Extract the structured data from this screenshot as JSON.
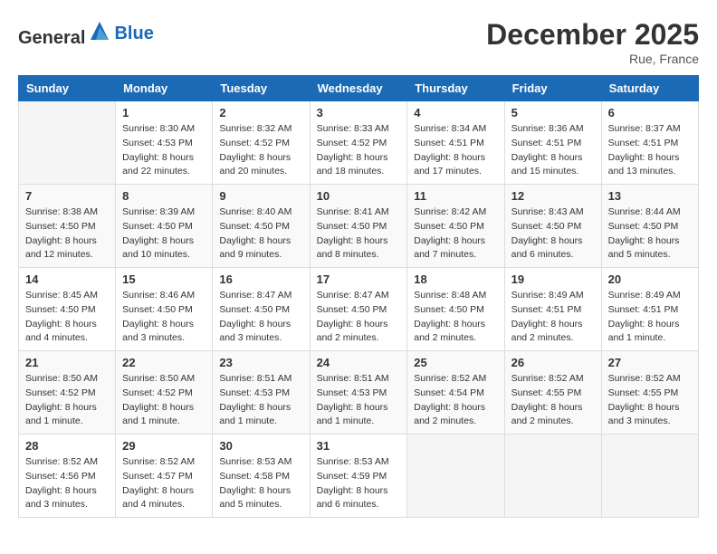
{
  "logo": {
    "general": "General",
    "blue": "Blue"
  },
  "header": {
    "month": "December 2025",
    "location": "Rue, France"
  },
  "weekdays": [
    "Sunday",
    "Monday",
    "Tuesday",
    "Wednesday",
    "Thursday",
    "Friday",
    "Saturday"
  ],
  "weeks": [
    [
      {
        "day": "",
        "sunrise": "",
        "sunset": "",
        "daylight": ""
      },
      {
        "day": "1",
        "sunrise": "8:30 AM",
        "sunset": "4:53 PM",
        "daylight": "8 hours and 22 minutes."
      },
      {
        "day": "2",
        "sunrise": "8:32 AM",
        "sunset": "4:52 PM",
        "daylight": "8 hours and 20 minutes."
      },
      {
        "day": "3",
        "sunrise": "8:33 AM",
        "sunset": "4:52 PM",
        "daylight": "8 hours and 18 minutes."
      },
      {
        "day": "4",
        "sunrise": "8:34 AM",
        "sunset": "4:51 PM",
        "daylight": "8 hours and 17 minutes."
      },
      {
        "day": "5",
        "sunrise": "8:36 AM",
        "sunset": "4:51 PM",
        "daylight": "8 hours and 15 minutes."
      },
      {
        "day": "6",
        "sunrise": "8:37 AM",
        "sunset": "4:51 PM",
        "daylight": "8 hours and 13 minutes."
      }
    ],
    [
      {
        "day": "7",
        "sunrise": "8:38 AM",
        "sunset": "4:50 PM",
        "daylight": "8 hours and 12 minutes."
      },
      {
        "day": "8",
        "sunrise": "8:39 AM",
        "sunset": "4:50 PM",
        "daylight": "8 hours and 10 minutes."
      },
      {
        "day": "9",
        "sunrise": "8:40 AM",
        "sunset": "4:50 PM",
        "daylight": "8 hours and 9 minutes."
      },
      {
        "day": "10",
        "sunrise": "8:41 AM",
        "sunset": "4:50 PM",
        "daylight": "8 hours and 8 minutes."
      },
      {
        "day": "11",
        "sunrise": "8:42 AM",
        "sunset": "4:50 PM",
        "daylight": "8 hours and 7 minutes."
      },
      {
        "day": "12",
        "sunrise": "8:43 AM",
        "sunset": "4:50 PM",
        "daylight": "8 hours and 6 minutes."
      },
      {
        "day": "13",
        "sunrise": "8:44 AM",
        "sunset": "4:50 PM",
        "daylight": "8 hours and 5 minutes."
      }
    ],
    [
      {
        "day": "14",
        "sunrise": "8:45 AM",
        "sunset": "4:50 PM",
        "daylight": "8 hours and 4 minutes."
      },
      {
        "day": "15",
        "sunrise": "8:46 AM",
        "sunset": "4:50 PM",
        "daylight": "8 hours and 3 minutes."
      },
      {
        "day": "16",
        "sunrise": "8:47 AM",
        "sunset": "4:50 PM",
        "daylight": "8 hours and 3 minutes."
      },
      {
        "day": "17",
        "sunrise": "8:47 AM",
        "sunset": "4:50 PM",
        "daylight": "8 hours and 2 minutes."
      },
      {
        "day": "18",
        "sunrise": "8:48 AM",
        "sunset": "4:50 PM",
        "daylight": "8 hours and 2 minutes."
      },
      {
        "day": "19",
        "sunrise": "8:49 AM",
        "sunset": "4:51 PM",
        "daylight": "8 hours and 2 minutes."
      },
      {
        "day": "20",
        "sunrise": "8:49 AM",
        "sunset": "4:51 PM",
        "daylight": "8 hours and 1 minute."
      }
    ],
    [
      {
        "day": "21",
        "sunrise": "8:50 AM",
        "sunset": "4:52 PM",
        "daylight": "8 hours and 1 minute."
      },
      {
        "day": "22",
        "sunrise": "8:50 AM",
        "sunset": "4:52 PM",
        "daylight": "8 hours and 1 minute."
      },
      {
        "day": "23",
        "sunrise": "8:51 AM",
        "sunset": "4:53 PM",
        "daylight": "8 hours and 1 minute."
      },
      {
        "day": "24",
        "sunrise": "8:51 AM",
        "sunset": "4:53 PM",
        "daylight": "8 hours and 1 minute."
      },
      {
        "day": "25",
        "sunrise": "8:52 AM",
        "sunset": "4:54 PM",
        "daylight": "8 hours and 2 minutes."
      },
      {
        "day": "26",
        "sunrise": "8:52 AM",
        "sunset": "4:55 PM",
        "daylight": "8 hours and 2 minutes."
      },
      {
        "day": "27",
        "sunrise": "8:52 AM",
        "sunset": "4:55 PM",
        "daylight": "8 hours and 3 minutes."
      }
    ],
    [
      {
        "day": "28",
        "sunrise": "8:52 AM",
        "sunset": "4:56 PM",
        "daylight": "8 hours and 3 minutes."
      },
      {
        "day": "29",
        "sunrise": "8:52 AM",
        "sunset": "4:57 PM",
        "daylight": "8 hours and 4 minutes."
      },
      {
        "day": "30",
        "sunrise": "8:53 AM",
        "sunset": "4:58 PM",
        "daylight": "8 hours and 5 minutes."
      },
      {
        "day": "31",
        "sunrise": "8:53 AM",
        "sunset": "4:59 PM",
        "daylight": "8 hours and 6 minutes."
      },
      {
        "day": "",
        "sunrise": "",
        "sunset": "",
        "daylight": ""
      },
      {
        "day": "",
        "sunrise": "",
        "sunset": "",
        "daylight": ""
      },
      {
        "day": "",
        "sunrise": "",
        "sunset": "",
        "daylight": ""
      }
    ]
  ]
}
